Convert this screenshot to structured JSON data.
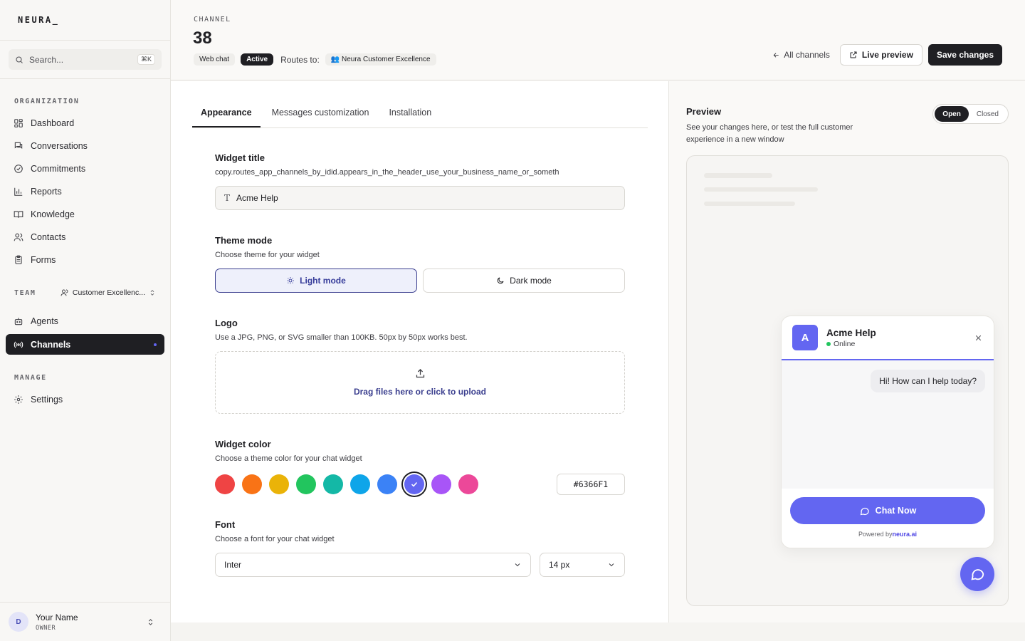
{
  "brand": "NEURA_",
  "search": {
    "placeholder": "Search...",
    "shortcut": "⌘K"
  },
  "sidebar": {
    "organization_label": "ORGANIZATION",
    "org_items": [
      {
        "label": "Dashboard",
        "icon": "dashboard-icon"
      },
      {
        "label": "Conversations",
        "icon": "conversations-icon"
      },
      {
        "label": "Commitments",
        "icon": "check-circle-icon"
      },
      {
        "label": "Reports",
        "icon": "bar-chart-icon"
      },
      {
        "label": "Knowledge",
        "icon": "book-icon"
      },
      {
        "label": "Contacts",
        "icon": "contacts-icon"
      },
      {
        "label": "Forms",
        "icon": "clipboard-icon"
      }
    ],
    "team_label": "TEAM",
    "team_selected": "Customer Excellenc...",
    "team_items": [
      {
        "label": "Agents",
        "icon": "bot-icon"
      },
      {
        "label": "Channels",
        "icon": "broadcast-icon",
        "active": true
      }
    ],
    "manage_label": "MANAGE",
    "manage_items": [
      {
        "label": "Settings",
        "icon": "gear-icon"
      }
    ]
  },
  "user": {
    "initial": "D",
    "name": "Your Name",
    "role": "OWNER"
  },
  "header": {
    "eyebrow": "CHANNEL",
    "channel_id": "38",
    "type_pill": "Web chat",
    "status_pill": "Active",
    "routes_label": "Routes to:",
    "route_team": "👥 Neura Customer Excellence",
    "all_channels": "All channels",
    "live_preview": "Live preview",
    "save": "Save changes"
  },
  "tabs": [
    {
      "label": "Appearance",
      "active": true
    },
    {
      "label": "Messages customization",
      "active": false
    },
    {
      "label": "Installation",
      "active": false
    }
  ],
  "form": {
    "widget_title": {
      "label": "Widget title",
      "description": "copy.routes_app_channels_by_idid.appears_in_the_header_use_your_business_name_or_someth",
      "value": "Acme Help"
    },
    "theme_mode": {
      "label": "Theme mode",
      "description": "Choose theme for your widget",
      "light": "Light mode",
      "dark": "Dark mode",
      "selected": "light"
    },
    "logo": {
      "label": "Logo",
      "description": "Use a JPG, PNG, or SVG smaller than 100KB. 50px by 50px works best.",
      "upload_text": "Drag files here or click to upload"
    },
    "widget_color": {
      "label": "Widget color",
      "description": "Choose a theme color for your chat widget",
      "swatches": [
        "#ef4444",
        "#f97316",
        "#eab308",
        "#22c55e",
        "#14b8a6",
        "#0ea5e9",
        "#3b82f6",
        "#6366f1",
        "#a855f7",
        "#ec4899"
      ],
      "selected": "#6366f1",
      "hex_value": "#6366F1"
    },
    "font": {
      "label": "Font",
      "description": "Choose a font for your chat widget",
      "family": "Inter",
      "size": "14 px"
    }
  },
  "preview": {
    "title": "Preview",
    "description": "See your changes here, or test the full customer experience in a new window",
    "toggle_open": "Open",
    "toggle_closed": "Closed",
    "widget": {
      "avatar_initial": "A",
      "title": "Acme Help",
      "status": "Online",
      "greeting": "Hi! How can I help today?",
      "chat_button": "Chat Now",
      "powered_by": "Powered by",
      "powered_brand": "neura.ai"
    }
  },
  "colors": {
    "accent": "#6366f1",
    "dark": "#1f1f23",
    "online": "#22c55e"
  }
}
